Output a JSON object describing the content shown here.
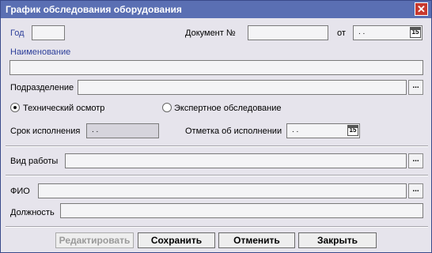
{
  "window": {
    "title": "График обследования оборудования",
    "close_glyph": "✕"
  },
  "form": {
    "year_label": "Год",
    "year_value": "",
    "document_label": "Документ №",
    "document_value": "",
    "from_label": "от",
    "from_date": ". .",
    "name_label": "Наименование",
    "name_value": "",
    "division_label": "Подразделение",
    "division_value": "",
    "radio_technical": "Технический осмотр",
    "radio_expert": "Экспертное обследование",
    "deadline_label": "Срок исполнения",
    "deadline_value": ". .",
    "completion_label": "Отметка об исполнении",
    "completion_date": ". .",
    "work_type_label": "Вид работы",
    "work_type_value": "",
    "fio_label": "ФИО",
    "fio_value": "",
    "position_label": "Должность",
    "position_value": "",
    "calendar_glyph": "15",
    "ellipsis_glyph": "..."
  },
  "buttons": {
    "edit": "Редактировать",
    "save": "Сохранить",
    "cancel": "Отменить",
    "close": "Закрыть"
  },
  "colors": {
    "titlebar": "#5a6fb3",
    "window_bg": "#e6e4ec",
    "label_accent": "#2d3f9a",
    "close_button": "#c8392e"
  },
  "icons": [
    "close-icon",
    "calendar-icon",
    "ellipsis-icon"
  ],
  "selected_radio": "technical"
}
